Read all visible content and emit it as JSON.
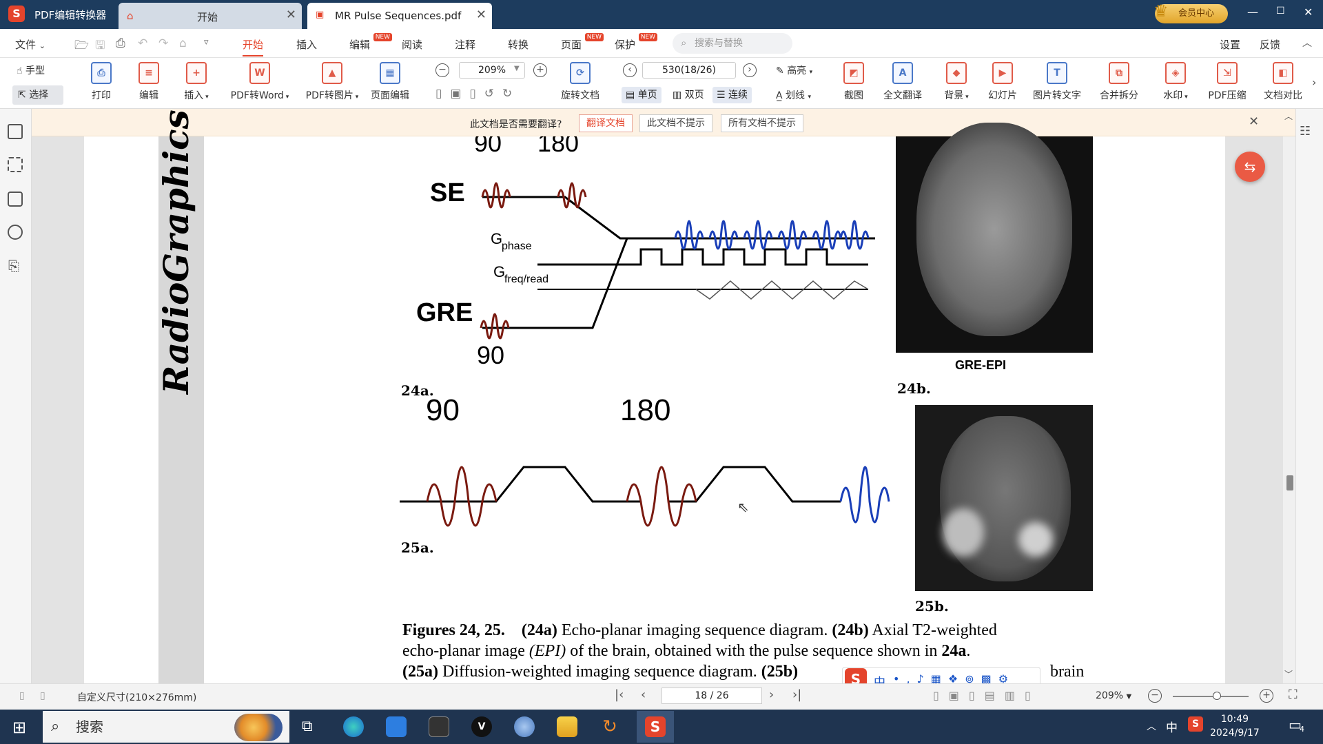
{
  "titlebar": {
    "app_name": "PDF编辑转换器",
    "tab_home": "开始",
    "tab_doc": "MR Pulse Sequences.pdf",
    "vip_label": "会员中心"
  },
  "menu": {
    "file": "文件",
    "items": [
      "开始",
      "插入",
      "编辑",
      "阅读",
      "注释",
      "转换",
      "页面",
      "保护"
    ],
    "new_badge": "NEW",
    "search_placeholder": "搜索与替换",
    "settings": "设置",
    "feedback": "反馈"
  },
  "ribbon": {
    "hand": "手型",
    "select": "选择",
    "print": "打印",
    "edit": "编辑",
    "insert": "插入",
    "to_word": "PDF转Word",
    "to_image": "PDF转图片",
    "page_edit": "页面编辑",
    "zoom": "209%",
    "rotate": "旋转文档",
    "page_field": "530(18/26)",
    "single": "单页",
    "double": "双页",
    "continuous": "连续",
    "highlight": "高亮",
    "strike": "划线",
    "screenshot": "截图",
    "translate_all": "全文翻译",
    "background": "背景",
    "slideshow": "幻灯片",
    "img_to_text": "图片转文字",
    "merge_split": "合并拆分",
    "watermark": "水印",
    "compress": "PDF压缩",
    "compare": "文档对比"
  },
  "translate_bar": {
    "question": "此文档是否需要翻译?",
    "translate_btn": "翻译文档",
    "not_this": "此文档不提示",
    "not_all": "所有文档不提示"
  },
  "document": {
    "journal": "RadioGraphics",
    "fig24a_labels": {
      "top90": "90",
      "top180": "180",
      "se": "SE",
      "gphase": "G",
      "gphase_sub": "phase",
      "gfreq": "G",
      "gfreq_sub": "freq/read",
      "gre": "GRE",
      "bottom90": "90"
    },
    "label_24a": "24a.",
    "label_24b": "24b.",
    "gre_epi": "GRE-EPI",
    "fig25a_90": "90",
    "fig25a_180": "180",
    "label_25a": "25a.",
    "label_25b": "25b.",
    "caption_line1_a": "Figures 24, 25.",
    "caption_line1_b": "(24a)",
    "caption_line1_c": " Echo-planar imaging sequence diagram. ",
    "caption_line1_d": "(24b)",
    "caption_line1_e": " Axial T2-weighted",
    "caption_line2_a": "echo-planar image ",
    "caption_line2_b": "(EPI)",
    "caption_line2_c": " of the brain, obtained with the pulse sequence shown in ",
    "caption_line2_d": "24a",
    "caption_line2_e": ".",
    "caption_line3_a": "(25a)",
    "caption_line3_b": " Diffusion-weighted imaging sequence diagram. ",
    "caption_line3_c": "(25b)",
    "caption_line3_d": "brain"
  },
  "statusbar": {
    "page_size": "自定义尺寸(210×276mm)",
    "page_nav": "18 / 26",
    "zoom": "209%"
  },
  "ime": {
    "lang": "中"
  },
  "taskbar": {
    "search": "搜索",
    "tray_lang": "中",
    "time": "10:49",
    "date": "2024/9/17",
    "notif": "4"
  },
  "colors": {
    "accent": "#e5442b",
    "titlebar": "#1d3c5e",
    "rf_pulse": "#7a1a10",
    "echo": "#1a3fb8"
  }
}
